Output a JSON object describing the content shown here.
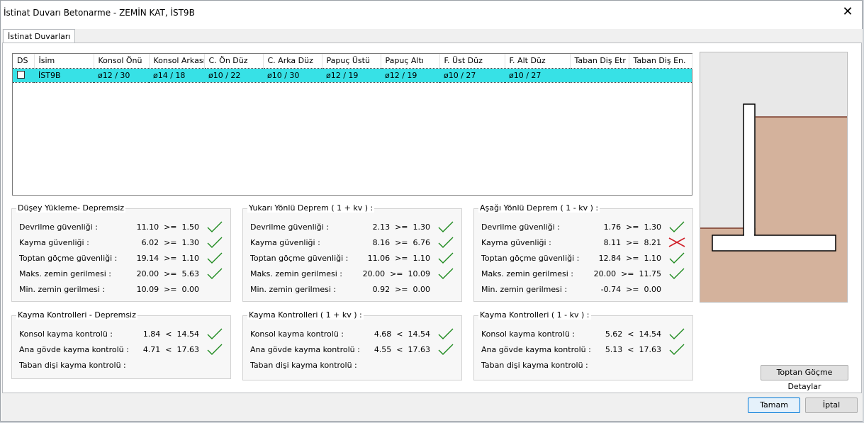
{
  "window": {
    "title": "İstinat Duvarı Betonarme - ZEMİN KAT, İST9B"
  },
  "tabs": [
    {
      "label": "İstinat Duvarları"
    }
  ],
  "table": {
    "columns": [
      "DS",
      "İsim",
      "Konsol Önü",
      "Konsol Arkası",
      "C. Ön Düz",
      "C. Arka Düz",
      "Papuç Üstü",
      "Papuç Altı",
      "F. Üst Düz",
      "F. Alt Düz",
      "Taban Diş Etr",
      "Taban Diş En."
    ],
    "rows": [
      {
        "ds": "",
        "cells": [
          "İST9B",
          "ø12 / 30",
          "ø14 / 18",
          "ø10 / 22",
          "ø10 / 30",
          "ø12 / 19",
          "ø12 / 19",
          "ø10 / 27",
          "ø10 / 27",
          "",
          ""
        ]
      }
    ]
  },
  "groups": {
    "duseyDepremsiz": {
      "title": "Düşey Yükleme- Depremsiz",
      "rows": [
        {
          "label": "Devrilme güvenliği :",
          "value": "11.10  >=  1.50",
          "status": "ok"
        },
        {
          "label": "Kayma güvenliği :",
          "value": "6.02  >=  1.30",
          "status": "ok"
        },
        {
          "label": "Toptan göçme güvenliği :",
          "value": "19.14  >=  1.10",
          "status": "ok"
        },
        {
          "label": "Maks. zemin gerilmesi :",
          "value": "20.00  >=  5.63",
          "status": "ok"
        },
        {
          "label": "Min. zemin gerilmesi :",
          "value": "10.09  >=  0.00",
          "status": "none"
        }
      ]
    },
    "yukariDeprem": {
      "title": "Yukarı Yönlü Deprem ( 1 + kv ) :",
      "rows": [
        {
          "label": "Devrilme güvenliği :",
          "value": "2.13  >=  1.30",
          "status": "ok"
        },
        {
          "label": "Kayma güvenliği :",
          "value": "8.16  >=  6.76",
          "status": "ok"
        },
        {
          "label": "Toptan göçme güvenliği :",
          "value": "11.06  >=  1.10",
          "status": "ok"
        },
        {
          "label": "Maks. zemin gerilmesi :",
          "value": "20.00  >=  10.09",
          "status": "ok"
        },
        {
          "label": "Min. zemin gerilmesi :",
          "value": "0.92  >=  0.00",
          "status": "none"
        }
      ]
    },
    "asagiDeprem": {
      "title": "Aşağı Yönlü Deprem ( 1 - kv ) :",
      "rows": [
        {
          "label": "Devrilme güvenliği :",
          "value": "1.76  >=  1.30",
          "status": "ok"
        },
        {
          "label": "Kayma güvenliği :",
          "value": "8.11  >=  8.21",
          "status": "fail"
        },
        {
          "label": "Toptan göçme güvenliği :",
          "value": "12.84  >=  1.10",
          "status": "ok"
        },
        {
          "label": "Maks. zemin gerilmesi :",
          "value": "20.00  >=  11.75",
          "status": "ok"
        },
        {
          "label": "Min. zemin gerilmesi :",
          "value": "-0.74  >=  0.00",
          "status": "none"
        }
      ]
    },
    "kaymaDepremsiz": {
      "title": "Kayma Kontrolleri - Depremsiz",
      "rows": [
        {
          "label": "Konsol kayma kontrolü :",
          "value": "1.84  <  14.54",
          "status": "ok"
        },
        {
          "label": "Ana gövde kayma kontrolü :",
          "value": "4.71  <  17.63",
          "status": "ok"
        },
        {
          "label": "Taban dişi kayma kontrolü :",
          "value": "",
          "status": "none"
        }
      ]
    },
    "kaymaYukari": {
      "title": "Kayma Kontrolleri ( 1 + kv ) :",
      "rows": [
        {
          "label": "Konsol kayma kontrolü :",
          "value": "4.68  <  14.54",
          "status": "ok"
        },
        {
          "label": "Ana gövde kayma kontrolü :",
          "value": "4.55  <  17.63",
          "status": "ok"
        },
        {
          "label": "Taban dişi kayma kontrolü :",
          "value": "",
          "status": "none"
        }
      ]
    },
    "kaymaAsagi": {
      "title": "Kayma Kontrolleri ( 1 - kv ) :",
      "rows": [
        {
          "label": "Konsol kayma kontrolü :",
          "value": "5.62  <  14.54",
          "status": "ok"
        },
        {
          "label": "Ana gövde kayma kontrolü :",
          "value": "5.13  <  17.63",
          "status": "ok"
        },
        {
          "label": "Taban dişi kayma kontrolü :",
          "value": "",
          "status": "none"
        }
      ]
    }
  },
  "buttons": {
    "detail": "Toptan Göçme Detaylar",
    "ok": "Tamam",
    "cancel": "İptal"
  },
  "colors": {
    "selection": "#37e1e6",
    "soil": "#d4b29c",
    "soilLine": "#7a3b2a",
    "checkGreen": "#1e8a1e",
    "crossRed": "#d0202a",
    "previewBg": "#e8e8e8"
  },
  "icons": {
    "ok": "check-icon",
    "fail": "cross-icon",
    "close": "close-icon"
  }
}
